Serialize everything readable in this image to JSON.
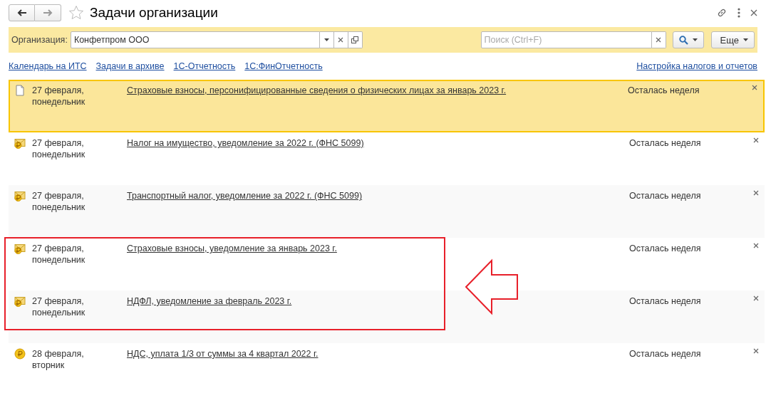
{
  "window": {
    "title": "Задачи организации",
    "favorite": false
  },
  "filter": {
    "label": "Организация:",
    "value": "Конфетпром ООО"
  },
  "search": {
    "placeholder": "Поиск (Ctrl+F)"
  },
  "more_button": "Еще",
  "links": [
    "Календарь на ИТС",
    "Задачи в архиве",
    "1С-Отчетность",
    "1С:ФинОтчетность"
  ],
  "settings_link": "Настройка налогов и отчетов",
  "tasks": [
    {
      "kind": "document",
      "date": "27 февраля,",
      "weekday": "понедельник",
      "title": "Страховые взносы, персонифицированные сведения о физических лицах за январь 2023 г.",
      "status": "Осталась неделя",
      "selected": true
    },
    {
      "kind": "notice",
      "date": "27 февраля,",
      "weekday": "понедельник",
      "title": "Налог на имущество, уведомление за 2022 г. (ФНС 5099)",
      "status": "Осталась неделя",
      "selected": false
    },
    {
      "kind": "notice",
      "date": "27 февраля,",
      "weekday": "понедельник",
      "title": "Транспортный налог, уведомление за 2022 г. (ФНС 5099)",
      "status": "Осталась неделя",
      "selected": false
    },
    {
      "kind": "notice",
      "date": "27 февраля,",
      "weekday": "понедельник",
      "title": "Страховые взносы, уведомление за январь 2023 г.",
      "status": "Осталась неделя",
      "selected": false
    },
    {
      "kind": "notice",
      "date": "27 февраля,",
      "weekday": "понедельник",
      "title": "НДФЛ, уведомление за февраль 2023 г.",
      "status": "Осталась неделя",
      "selected": false
    },
    {
      "kind": "payment",
      "date": "28 февраля,",
      "weekday": "вторник",
      "title": "НДС, уплата 1/3 от суммы за 4 квартал 2022 г.",
      "status": "Осталась неделя",
      "selected": false
    }
  ]
}
